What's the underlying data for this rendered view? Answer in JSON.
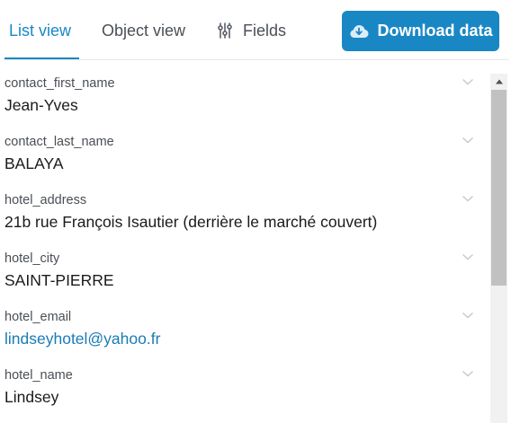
{
  "tabs": {
    "list_view": "List view",
    "object_view": "Object view",
    "fields": "Fields"
  },
  "download_button": "Download data",
  "colors": {
    "accent": "#1a87c5",
    "link": "#1a7bb5"
  },
  "icons": {
    "fields_tab": "sliders-icon",
    "download": "cloud-download-icon",
    "expand": "chevron-down-icon",
    "scroll_up": "triangle-up-icon"
  },
  "fields": [
    {
      "name": "contact_first_name",
      "value": "Jean-Yves"
    },
    {
      "name": "contact_last_name",
      "value": "BALAYA"
    },
    {
      "name": "hotel_address",
      "value": "21b rue François Isautier (derrière le marché couvert)"
    },
    {
      "name": "hotel_city",
      "value": "SAINT-PIERRE"
    },
    {
      "name": "hotel_email",
      "value": "lindseyhotel@yahoo.fr"
    },
    {
      "name": "hotel_name",
      "value": "Lindsey"
    }
  ]
}
